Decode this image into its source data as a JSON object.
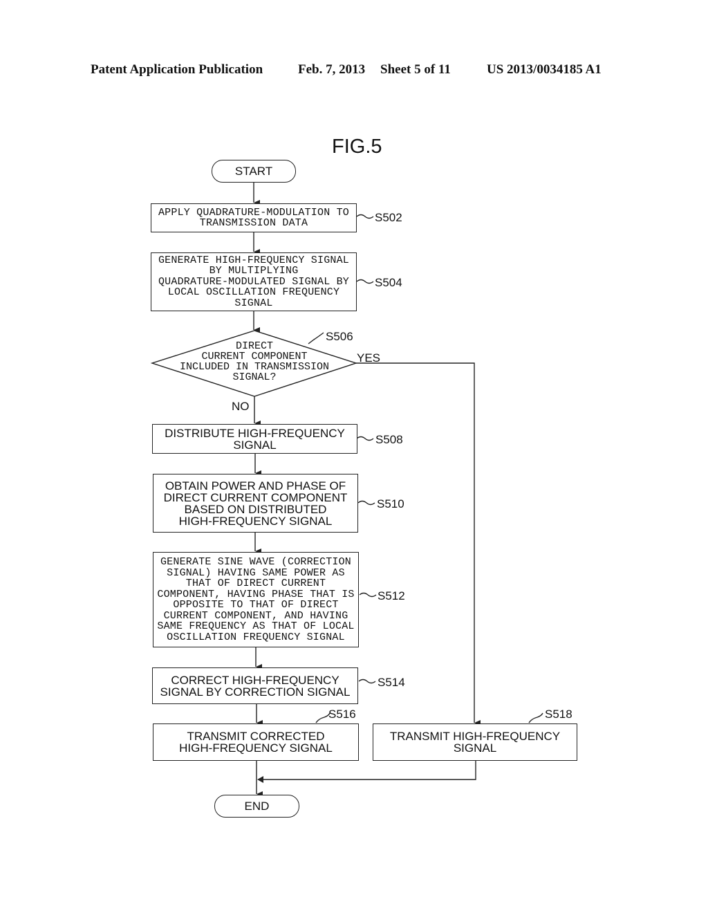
{
  "header": {
    "publication": "Patent Application Publication",
    "date": "Feb. 7, 2013",
    "sheet": "Sheet 5 of 11",
    "number": "US 2013/0034185 A1"
  },
  "figure": {
    "title": "FIG.5",
    "start": "START",
    "end": "END",
    "steps": {
      "s502": {
        "id": "S502",
        "lines": [
          "APPLY QUADRATURE-MODULATION TO",
          "TRANSMISSION DATA"
        ]
      },
      "s504": {
        "id": "S504",
        "lines": [
          "GENERATE HIGH-FREQUENCY SIGNAL",
          "BY MULTIPLYING",
          "QUADRATURE-MODULATED SIGNAL BY",
          "LOCAL OSCILLATION FREQUENCY",
          "SIGNAL"
        ]
      },
      "s506": {
        "id": "S506",
        "lines": [
          "DIRECT",
          "CURRENT COMPONENT",
          "INCLUDED IN TRANSMISSION",
          "SIGNAL?"
        ],
        "yes": "YES",
        "no": "NO"
      },
      "s508": {
        "id": "S508",
        "lines": [
          "DISTRIBUTE HIGH-FREQUENCY",
          "SIGNAL"
        ]
      },
      "s510": {
        "id": "S510",
        "lines": [
          "OBTAIN POWER AND PHASE OF",
          "DIRECT CURRENT COMPONENT",
          "BASED ON DISTRIBUTED",
          "HIGH-FREQUENCY SIGNAL"
        ]
      },
      "s512": {
        "id": "S512",
        "lines": [
          "GENERATE SINE WAVE (CORRECTION",
          "SIGNAL) HAVING SAME POWER AS",
          "THAT OF DIRECT CURRENT",
          "COMPONENT, HAVING PHASE THAT IS",
          "OPPOSITE TO THAT OF DIRECT",
          "CURRENT COMPONENT, AND HAVING",
          "SAME FREQUENCY AS THAT OF LOCAL",
          "OSCILLATION FREQUENCY SIGNAL"
        ]
      },
      "s514": {
        "id": "S514",
        "lines": [
          "CORRECT HIGH-FREQUENCY",
          "SIGNAL BY CORRECTION SIGNAL"
        ]
      },
      "s516": {
        "id": "S516",
        "lines": [
          "TRANSMIT CORRECTED",
          "HIGH-FREQUENCY SIGNAL"
        ]
      },
      "s518": {
        "id": "S518",
        "lines": [
          "TRANSMIT HIGH-FREQUENCY",
          "SIGNAL"
        ]
      }
    }
  }
}
